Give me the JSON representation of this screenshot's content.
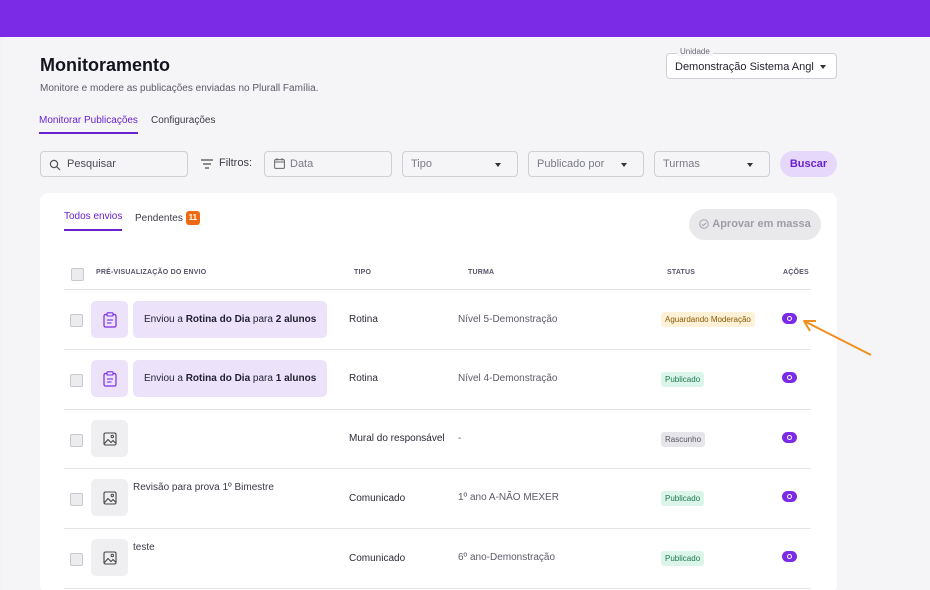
{
  "header": {
    "title": "Monitoramento",
    "subtitle": "Monitore e modere as publicações enviadas no Plurall Família."
  },
  "unit_select": {
    "label": "Unidade",
    "value": "Demonstração Sistema Angl"
  },
  "top_tabs": [
    {
      "label": "Monitorar Publicações",
      "active": true
    },
    {
      "label": "Configurações",
      "active": false
    }
  ],
  "filters": {
    "search_placeholder": "Pesquisar",
    "filters_label": "Filtros:",
    "date_placeholder": "Data",
    "type_placeholder": "Tipo",
    "published_by_placeholder": "Publicado por",
    "classes_placeholder": "Turmas",
    "search_button": "Buscar"
  },
  "content_tabs": {
    "all_label": "Todos envios",
    "pending_label": "Pendentes",
    "pending_count": "11"
  },
  "bulk_approve_label": "Aprovar em massa",
  "table": {
    "headers": {
      "preview": "PRÉ-VISUALIZAÇÃO DO ENVIO",
      "type": "TIPO",
      "class": "TURMA",
      "status": "STATUS",
      "actions": "AÇÕES"
    },
    "rows": [
      {
        "thumb_icon": "clipboard-icon",
        "preview_prefix": "Enviou a ",
        "preview_bold1": "Rotina do Dia",
        "preview_mid": " para ",
        "preview_bold2": "2 alunos",
        "type": "Rotina",
        "class": "Nível 5-Demonstração",
        "status": "Aguardando Moderação"
      },
      {
        "thumb_icon": "clipboard-icon",
        "preview_prefix": "Enviou a ",
        "preview_bold1": "Rotina do Dia",
        "preview_mid": " para ",
        "preview_bold2": "1 alunos",
        "type": "Rotina",
        "class": "Nível 4-Demonstração",
        "status": "Publicado"
      },
      {
        "thumb_icon": "image-icon",
        "preview_text": "",
        "type": "Mural do responsável",
        "class": "-",
        "status": "Rascunho"
      },
      {
        "thumb_icon": "image-icon",
        "preview_text": "Revisão para prova 1º Bimestre",
        "type": "Comunicado",
        "class": "1º ano A-NÃO MEXER",
        "status": "Publicado"
      },
      {
        "thumb_icon": "image-icon",
        "preview_text": "teste",
        "type": "Comunicado",
        "class": "6º ano-Demonstração",
        "status": "Publicado"
      }
    ]
  },
  "colors": {
    "brand": "#7b2be6",
    "accent_text": "#6a22d0",
    "badge_orange": "#ee6a12",
    "annotation_arrow": "#f0901e"
  }
}
